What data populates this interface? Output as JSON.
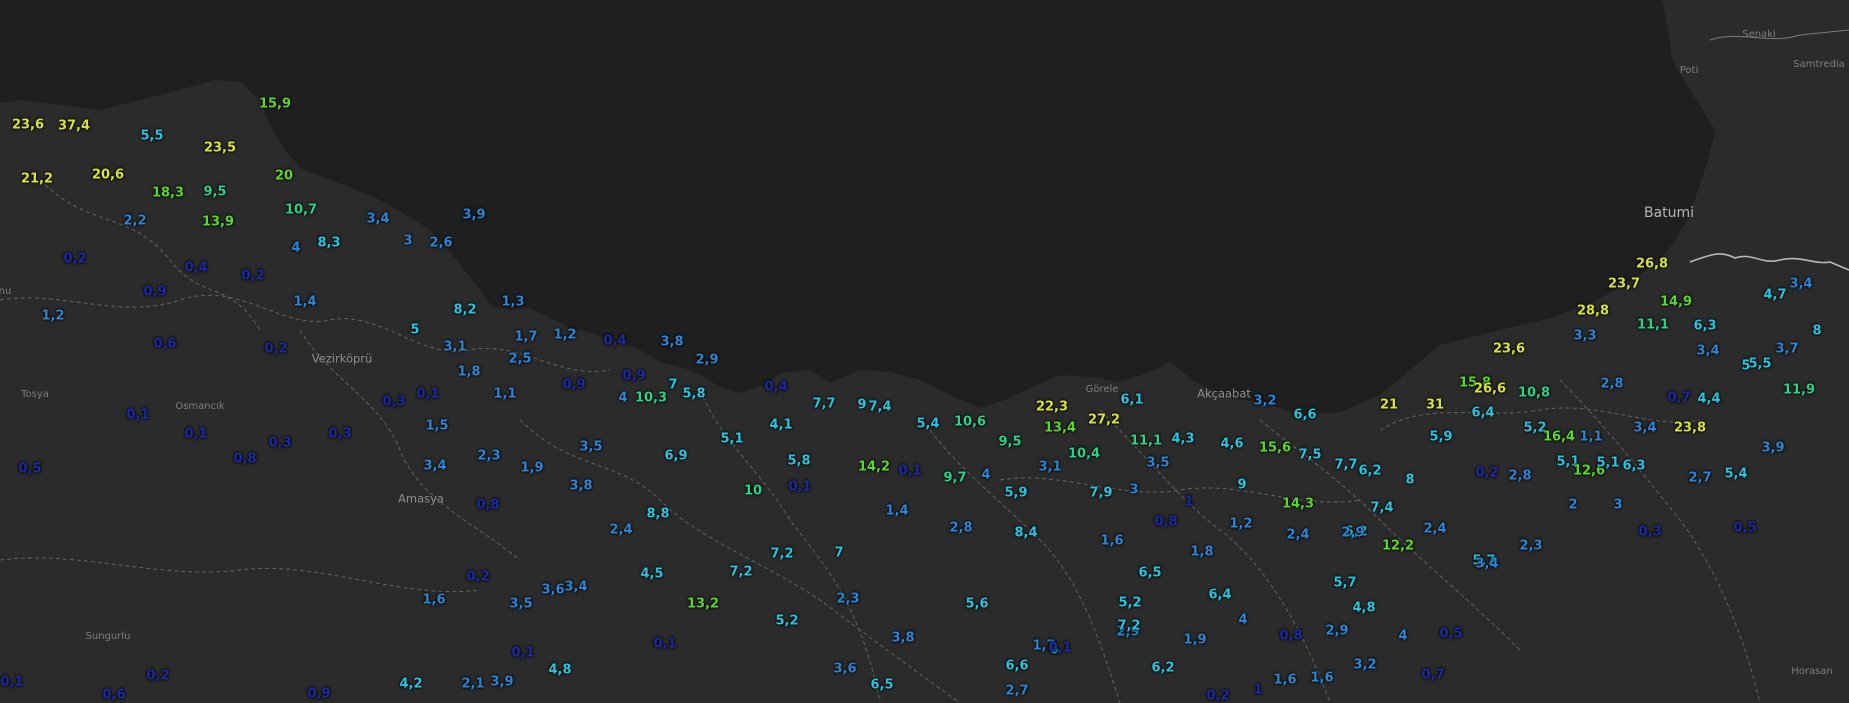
{
  "colors": {
    "land": "#2b2b2c",
    "sea": "#1f1f20",
    "border": "#777777",
    "road": "#3a3a3b",
    "place_label": "#8e8e90"
  },
  "value_scale": [
    {
      "max": 1.0,
      "color": "#1c2aa6"
    },
    {
      "max": 4.0,
      "color": "#2b86d8"
    },
    {
      "max": 9.0,
      "color": "#25c6e0"
    },
    {
      "max": 12.0,
      "color": "#29d488"
    },
    {
      "max": 20.0,
      "color": "#5cd82c"
    },
    {
      "max": 999,
      "color": "#d8e43a"
    }
  ],
  "places": {
    "batumi": "Batumi",
    "senaki": "Senaki",
    "poti": "Poti",
    "samtredia": "Samtredia",
    "vezirkopru": "Vezirköprü",
    "tosya": "Tosya",
    "osmancik": "Osmancık",
    "amasya": "Amasya",
    "gorele": "Görele",
    "akcaabat": "Akçaabat",
    "sungurlu": "Sungurlu",
    "horasan": "Horasan",
    "edge_left": "nu"
  },
  "values": [
    "23,6",
    "37,4",
    "5,5",
    "23,5",
    "15,9",
    "21,2",
    "20,6",
    "18,3",
    "9,5",
    "20",
    "13,9",
    "10,7",
    "2,2",
    "3,4",
    "3,9",
    "0,2",
    "4",
    "8,3",
    "3",
    "2,6",
    "0,4",
    "0,2",
    "0,9",
    "1,4",
    "1,2",
    "8,2",
    "1,3",
    "0,6",
    "0,2",
    "5",
    "3,1",
    "1,7",
    "1,2",
    "0,4",
    "3,8",
    "2,9",
    "2,5",
    "1,8",
    "0,9",
    "0,9",
    "0,3",
    "0,1",
    "1,1",
    "7",
    "10,3",
    "4",
    "5,8",
    "0,4",
    "0,1",
    "0,1",
    "0,3",
    "0,3",
    "1,5",
    "7,7",
    "9",
    "7,4",
    "5,4",
    "10,6",
    "22,3",
    "13,4",
    "27,2",
    "6,1",
    "3,2",
    "6,6",
    "0,5",
    "0,8",
    "2,3",
    "3,5",
    "4,1",
    "5,1",
    "6,9",
    "9,5",
    "11,1",
    "4,3",
    "3,4",
    "1,9",
    "5,8",
    "10,4",
    "4,6",
    "15,6",
    "7,5",
    "3,8",
    "10",
    "14,2",
    "0,1",
    "9,7",
    "4",
    "3,1",
    "7,9",
    "3",
    "3,5",
    "9",
    "7,7",
    "6,2",
    "0,1",
    "0,8",
    "8,8",
    "2,4",
    "1,4",
    "5,9",
    "1",
    "14,3",
    "7,4",
    "2,4",
    "6,2",
    "2,8",
    "8,4",
    "0,8",
    "1,2",
    "2,9",
    "7,2",
    "7",
    "1,6",
    "1,8",
    "2,4",
    "12,2",
    "0,2",
    "7,2",
    "6,5",
    "4,5",
    "3,4",
    "3,6",
    "5,7",
    "5,7",
    "1,6",
    "3,5",
    "13,2",
    "2,3",
    "4,8",
    "6,4",
    "5,6",
    "5,2",
    "5,2",
    "4",
    "0,1",
    "3,8",
    "2,9",
    "6",
    "0,5",
    "1,7",
    "7,2",
    "1,9",
    "0,8",
    "2,9",
    "4",
    "6,6",
    "0,1",
    "4,8",
    "0,1",
    "6,2",
    "3,2",
    "1,6",
    "1,6",
    "0,2",
    "3,6",
    "0,7",
    "4,2",
    "2,1",
    "3,9",
    "1",
    "6,5",
    "0,1",
    "2,7",
    "0,6",
    "0,9",
    "0,2",
    "26,8",
    "3,4",
    "23,7",
    "14,9",
    "4,7",
    "28,8",
    "11,1",
    "6,3",
    "8",
    "3,3",
    "3,4",
    "3,7",
    "23,6",
    "5,5",
    "15,8",
    "26,6",
    "10,8",
    "2,8",
    "0,7",
    "4,4",
    "5",
    "11,9",
    "21",
    "31",
    "6,4",
    "5,2",
    "1,1",
    "5,9",
    "16,4",
    "23,8",
    "3,4",
    "3,9",
    "5,1",
    "6,3",
    "2,7",
    "0,2",
    "12,6",
    "5,1",
    "5,4",
    "8",
    "2,8",
    "2",
    "3",
    "3,4",
    "2,3",
    "0,3",
    "0,5"
  ]
}
